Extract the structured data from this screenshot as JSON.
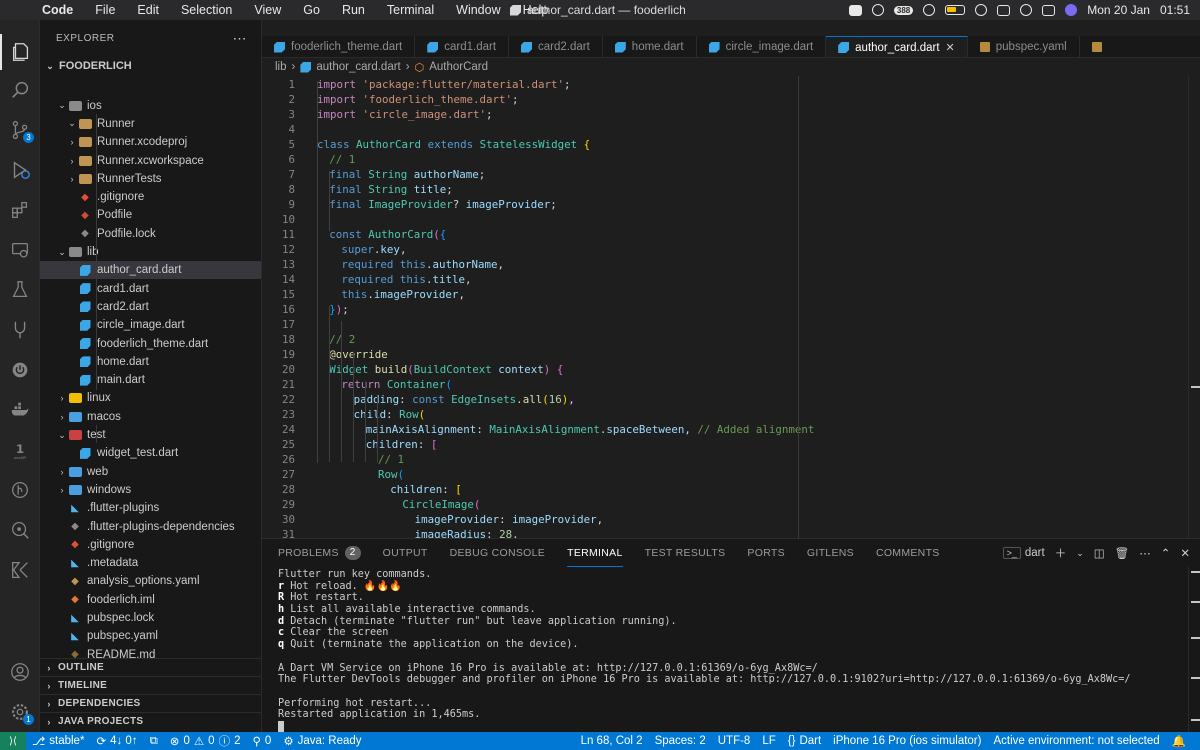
{
  "menubar": {
    "app": "Code",
    "items": [
      "File",
      "Edit",
      "Selection",
      "View",
      "Go",
      "Run",
      "Terminal",
      "Window",
      "Help"
    ],
    "window_title": "author_card.dart — fooderlich",
    "badge": "388",
    "date": "Mon 20 Jan",
    "time": "01:51"
  },
  "activity": {
    "source_control_count": "3",
    "settings_count": "1"
  },
  "sidebar": {
    "title": "EXPLORER",
    "root": "FOODERLICH",
    "items": [
      {
        "label": "ios",
        "depth": 1,
        "kind": "folder-open",
        "color": "#8a8a8a"
      },
      {
        "label": "Runner",
        "depth": 2,
        "kind": "folder-open",
        "color": "#c09553"
      },
      {
        "label": "Runner.xcodeproj",
        "depth": 2,
        "kind": "folder",
        "color": "#c09553"
      },
      {
        "label": "Runner.xcworkspace",
        "depth": 2,
        "kind": "folder",
        "color": "#c09553"
      },
      {
        "label": "RunnerTests",
        "depth": 2,
        "kind": "folder",
        "color": "#c09553"
      },
      {
        "label": ".gitignore",
        "depth": 2,
        "kind": "file",
        "color": "#e44d3a"
      },
      {
        "label": "Podfile",
        "depth": 2,
        "kind": "file",
        "color": "#d24939"
      },
      {
        "label": "Podfile.lock",
        "depth": 2,
        "kind": "file",
        "color": "#8a8a8a"
      },
      {
        "label": "lib",
        "depth": 1,
        "kind": "folder-open",
        "color": "#8a8a8a"
      },
      {
        "label": "author_card.dart",
        "depth": 2,
        "kind": "dart",
        "selected": true
      },
      {
        "label": "card1.dart",
        "depth": 2,
        "kind": "dart"
      },
      {
        "label": "card2.dart",
        "depth": 2,
        "kind": "dart"
      },
      {
        "label": "circle_image.dart",
        "depth": 2,
        "kind": "dart"
      },
      {
        "label": "fooderlich_theme.dart",
        "depth": 2,
        "kind": "dart"
      },
      {
        "label": "home.dart",
        "depth": 2,
        "kind": "dart"
      },
      {
        "label": "main.dart",
        "depth": 2,
        "kind": "dart"
      },
      {
        "label": "linux",
        "depth": 1,
        "kind": "folder",
        "color": "#f0c000"
      },
      {
        "label": "macos",
        "depth": 1,
        "kind": "folder",
        "color": "#4a9fe0"
      },
      {
        "label": "test",
        "depth": 1,
        "kind": "folder-open",
        "color": "#c94141"
      },
      {
        "label": "widget_test.dart",
        "depth": 2,
        "kind": "dart"
      },
      {
        "label": "web",
        "depth": 1,
        "kind": "folder",
        "color": "#4a9fe0"
      },
      {
        "label": "windows",
        "depth": 1,
        "kind": "folder",
        "color": "#4a9fe0"
      },
      {
        "label": ".flutter-plugins",
        "depth": 1,
        "kind": "flutter"
      },
      {
        "label": ".flutter-plugins-dependencies",
        "depth": 1,
        "kind": "file",
        "color": "#8a8a8a"
      },
      {
        "label": ".gitignore",
        "depth": 1,
        "kind": "file",
        "color": "#e44d3a"
      },
      {
        "label": ".metadata",
        "depth": 1,
        "kind": "flutter"
      },
      {
        "label": "analysis_options.yaml",
        "depth": 1,
        "kind": "file",
        "color": "#c09553"
      },
      {
        "label": "fooderlich.iml",
        "depth": 1,
        "kind": "file",
        "color": "#e37933"
      },
      {
        "label": "pubspec.lock",
        "depth": 1,
        "kind": "flutter"
      },
      {
        "label": "pubspec.yaml",
        "depth": 1,
        "kind": "flutter"
      },
      {
        "label": "README.md",
        "depth": 1,
        "kind": "file",
        "color": "#8a6a3a"
      }
    ],
    "sections": [
      "OUTLINE",
      "TIMELINE",
      "DEPENDENCIES",
      "JAVA PROJECTS"
    ]
  },
  "tabs": [
    {
      "label": "fooderlich_theme.dart",
      "active": false
    },
    {
      "label": "card1.dart",
      "active": false
    },
    {
      "label": "card2.dart",
      "active": false
    },
    {
      "label": "home.dart",
      "active": false
    },
    {
      "label": "circle_image.dart",
      "active": false
    },
    {
      "label": "author_card.dart",
      "active": true
    },
    {
      "label": "pubspec.yaml",
      "active": false
    }
  ],
  "breadcrumb": {
    "folder": "lib",
    "file": "author_card.dart",
    "symbol": "AuthorCard"
  },
  "code": [
    {
      "n": "1",
      "indent": 0,
      "parts": [
        [
          "kw2",
          "import"
        ],
        [
          "",
          " "
        ],
        [
          "str",
          "'package:flutter/material.dart'"
        ],
        [
          "",
          ";"
        ]
      ]
    },
    {
      "n": "2",
      "indent": 0,
      "parts": [
        [
          "kw2",
          "import"
        ],
        [
          "",
          " "
        ],
        [
          "str",
          "'fooderlich_theme.dart'"
        ],
        [
          "",
          ";"
        ]
      ]
    },
    {
      "n": "3",
      "indent": 0,
      "parts": [
        [
          "kw2",
          "import"
        ],
        [
          "",
          " "
        ],
        [
          "str",
          "'circle_image.dart'"
        ],
        [
          "",
          ";"
        ]
      ]
    },
    {
      "n": "4",
      "indent": 0,
      "parts": []
    },
    {
      "n": "5",
      "indent": 0,
      "parts": [
        [
          "kw",
          "class"
        ],
        [
          "",
          " "
        ],
        [
          "ty",
          "AuthorCard"
        ],
        [
          "",
          " "
        ],
        [
          "kw",
          "extends"
        ],
        [
          "",
          " "
        ],
        [
          "ty",
          "StatelessWidget"
        ],
        [
          "",
          " "
        ],
        [
          "br1",
          "{"
        ]
      ]
    },
    {
      "n": "6",
      "indent": 1,
      "parts": [
        [
          "cm",
          "// 1"
        ]
      ]
    },
    {
      "n": "7",
      "indent": 1,
      "parts": [
        [
          "kw",
          "final"
        ],
        [
          "",
          " "
        ],
        [
          "ty",
          "String"
        ],
        [
          "",
          " "
        ],
        [
          "vr",
          "authorName"
        ],
        [
          "",
          ";"
        ]
      ]
    },
    {
      "n": "8",
      "indent": 1,
      "parts": [
        [
          "kw",
          "final"
        ],
        [
          "",
          " "
        ],
        [
          "ty",
          "String"
        ],
        [
          "",
          " "
        ],
        [
          "vr",
          "title"
        ],
        [
          "",
          ";"
        ]
      ]
    },
    {
      "n": "9",
      "indent": 1,
      "parts": [
        [
          "kw",
          "final"
        ],
        [
          "",
          " "
        ],
        [
          "ty",
          "ImageProvider"
        ],
        [
          "",
          "? "
        ],
        [
          "vr",
          "imageProvider"
        ],
        [
          "",
          ";"
        ]
      ]
    },
    {
      "n": "10",
      "indent": 1,
      "parts": []
    },
    {
      "n": "11",
      "indent": 1,
      "parts": [
        [
          "kw",
          "const"
        ],
        [
          "",
          " "
        ],
        [
          "ty",
          "AuthorCard"
        ],
        [
          "br2",
          "("
        ],
        [
          "br3",
          "{"
        ]
      ]
    },
    {
      "n": "12",
      "indent": 2,
      "parts": [
        [
          "kw",
          "super"
        ],
        [
          "",
          "."
        ],
        [
          "vr",
          "key"
        ],
        [
          "",
          ","
        ]
      ]
    },
    {
      "n": "13",
      "indent": 2,
      "parts": [
        [
          "kw",
          "required"
        ],
        [
          "",
          " "
        ],
        [
          "kw",
          "this"
        ],
        [
          "",
          "."
        ],
        [
          "vr",
          "authorName"
        ],
        [
          "",
          ","
        ]
      ]
    },
    {
      "n": "14",
      "indent": 2,
      "parts": [
        [
          "kw",
          "required"
        ],
        [
          "",
          " "
        ],
        [
          "kw",
          "this"
        ],
        [
          "",
          "."
        ],
        [
          "vr",
          "title"
        ],
        [
          "",
          ","
        ]
      ]
    },
    {
      "n": "15",
      "indent": 2,
      "parts": [
        [
          "kw",
          "this"
        ],
        [
          "",
          "."
        ],
        [
          "vr",
          "imageProvider"
        ],
        [
          "",
          ","
        ]
      ]
    },
    {
      "n": "16",
      "indent": 1,
      "parts": [
        [
          "br3",
          "}"
        ],
        [
          "br2",
          ")"
        ],
        [
          "",
          ";"
        ]
      ]
    },
    {
      "n": "17",
      "indent": 1,
      "parts": []
    },
    {
      "n": "18",
      "indent": 1,
      "parts": [
        [
          "cm",
          "// 2"
        ]
      ]
    },
    {
      "n": "19",
      "indent": 1,
      "parts": [
        [
          "ann",
          "@override"
        ]
      ]
    },
    {
      "n": "20",
      "indent": 1,
      "parts": [
        [
          "ty",
          "Widget"
        ],
        [
          "",
          " "
        ],
        [
          "fn",
          "build"
        ],
        [
          "br2",
          "("
        ],
        [
          "ty",
          "BuildContext"
        ],
        [
          "",
          " "
        ],
        [
          "vr",
          "context"
        ],
        [
          "br2",
          ")"
        ],
        [
          "",
          " "
        ],
        [
          "br2",
          "{"
        ]
      ]
    },
    {
      "n": "21",
      "indent": 2,
      "parts": [
        [
          "kw2",
          "return"
        ],
        [
          "",
          " "
        ],
        [
          "ty",
          "Container"
        ],
        [
          "br3",
          "("
        ]
      ]
    },
    {
      "n": "22",
      "indent": 3,
      "parts": [
        [
          "vr",
          "padding"
        ],
        [
          "",
          ": "
        ],
        [
          "kw",
          "const"
        ],
        [
          "",
          " "
        ],
        [
          "ty",
          "EdgeInsets"
        ],
        [
          "",
          "."
        ],
        [
          "fn",
          "all"
        ],
        [
          "br1",
          "("
        ],
        [
          "num",
          "16"
        ],
        [
          "br1",
          ")"
        ],
        [
          "",
          ","
        ]
      ]
    },
    {
      "n": "23",
      "indent": 3,
      "parts": [
        [
          "vr",
          "child"
        ],
        [
          "",
          ": "
        ],
        [
          "ty",
          "Row"
        ],
        [
          "br1",
          "("
        ]
      ]
    },
    {
      "n": "24",
      "indent": 4,
      "parts": [
        [
          "vr",
          "mainAxisAlignment"
        ],
        [
          "",
          ": "
        ],
        [
          "ty",
          "MainAxisAlignment"
        ],
        [
          "",
          "."
        ],
        [
          "vr",
          "spaceBetween"
        ],
        [
          "",
          ", "
        ],
        [
          "cm",
          "// Added alignment"
        ]
      ]
    },
    {
      "n": "25",
      "indent": 4,
      "parts": [
        [
          "vr",
          "children"
        ],
        [
          "",
          ": "
        ],
        [
          "br2",
          "["
        ]
      ]
    },
    {
      "n": "26",
      "indent": 5,
      "parts": [
        [
          "cm",
          "// 1"
        ]
      ]
    },
    {
      "n": "27",
      "indent": 5,
      "parts": [
        [
          "ty",
          "Row"
        ],
        [
          "br3",
          "("
        ]
      ]
    },
    {
      "n": "28",
      "indent": 6,
      "parts": [
        [
          "vr",
          "children"
        ],
        [
          "",
          ": "
        ],
        [
          "br1",
          "["
        ]
      ]
    },
    {
      "n": "29",
      "indent": 7,
      "parts": [
        [
          "ty",
          "CircleImage"
        ],
        [
          "br2",
          "("
        ]
      ]
    },
    {
      "n": "30",
      "indent": 8,
      "parts": [
        [
          "vr",
          "imageProvider"
        ],
        [
          "",
          ": "
        ],
        [
          "vr",
          "imageProvider"
        ],
        [
          "",
          ","
        ]
      ]
    },
    {
      "n": "31",
      "indent": 8,
      "parts": [
        [
          "vr",
          "imageRadius"
        ],
        [
          "",
          ": "
        ],
        [
          "num",
          "28"
        ],
        [
          "",
          ","
        ]
      ]
    }
  ],
  "panel": {
    "tabs": [
      "PROBLEMS",
      "OUTPUT",
      "DEBUG CONSOLE",
      "TERMINAL",
      "TEST RESULTS",
      "PORTS",
      "GITLENS",
      "COMMENTS"
    ],
    "active_tab": "TERMINAL",
    "problems_count": "2",
    "terminal_name": "dart"
  },
  "terminal": [
    {
      "key": "",
      "text": "Flutter run key commands."
    },
    {
      "key": "r",
      "text": " Hot reload. 🔥🔥🔥"
    },
    {
      "key": "R",
      "text": " Hot restart."
    },
    {
      "key": "h",
      "text": " List all available interactive commands."
    },
    {
      "key": "d",
      "text": " Detach (terminate \"flutter run\" but leave application running)."
    },
    {
      "key": "c",
      "text": " Clear the screen"
    },
    {
      "key": "q",
      "text": " Quit (terminate the application on the device)."
    },
    {
      "key": "",
      "text": ""
    },
    {
      "key": "",
      "text": "A Dart VM Service on iPhone 16 Pro is available at: http://127.0.0.1:61369/o-6yg_Ax8Wc=/"
    },
    {
      "key": "",
      "text": "The Flutter DevTools debugger and profiler on iPhone 16 Pro is available at: http://127.0.0.1:9102?uri=http://127.0.0.1:61369/o-6yg_Ax8Wc=/"
    },
    {
      "key": "",
      "text": ""
    },
    {
      "key": "",
      "text": "Performing hot restart..."
    },
    {
      "key": "",
      "text": "Restarted application in 1,465ms."
    }
  ],
  "statusbar": {
    "branch": "stable*",
    "sync": "4↓ 0↑",
    "errors": "0",
    "warnings": "0",
    "info": "2",
    "ports": "0",
    "java": "Java: Ready",
    "position": "Ln 68, Col 2",
    "spaces": "Spaces: 2",
    "encoding": "UTF-8",
    "eol": "LF",
    "language": "Dart",
    "device": "iPhone 16 Pro (ios simulator)",
    "environment": "Active environment: not selected"
  }
}
